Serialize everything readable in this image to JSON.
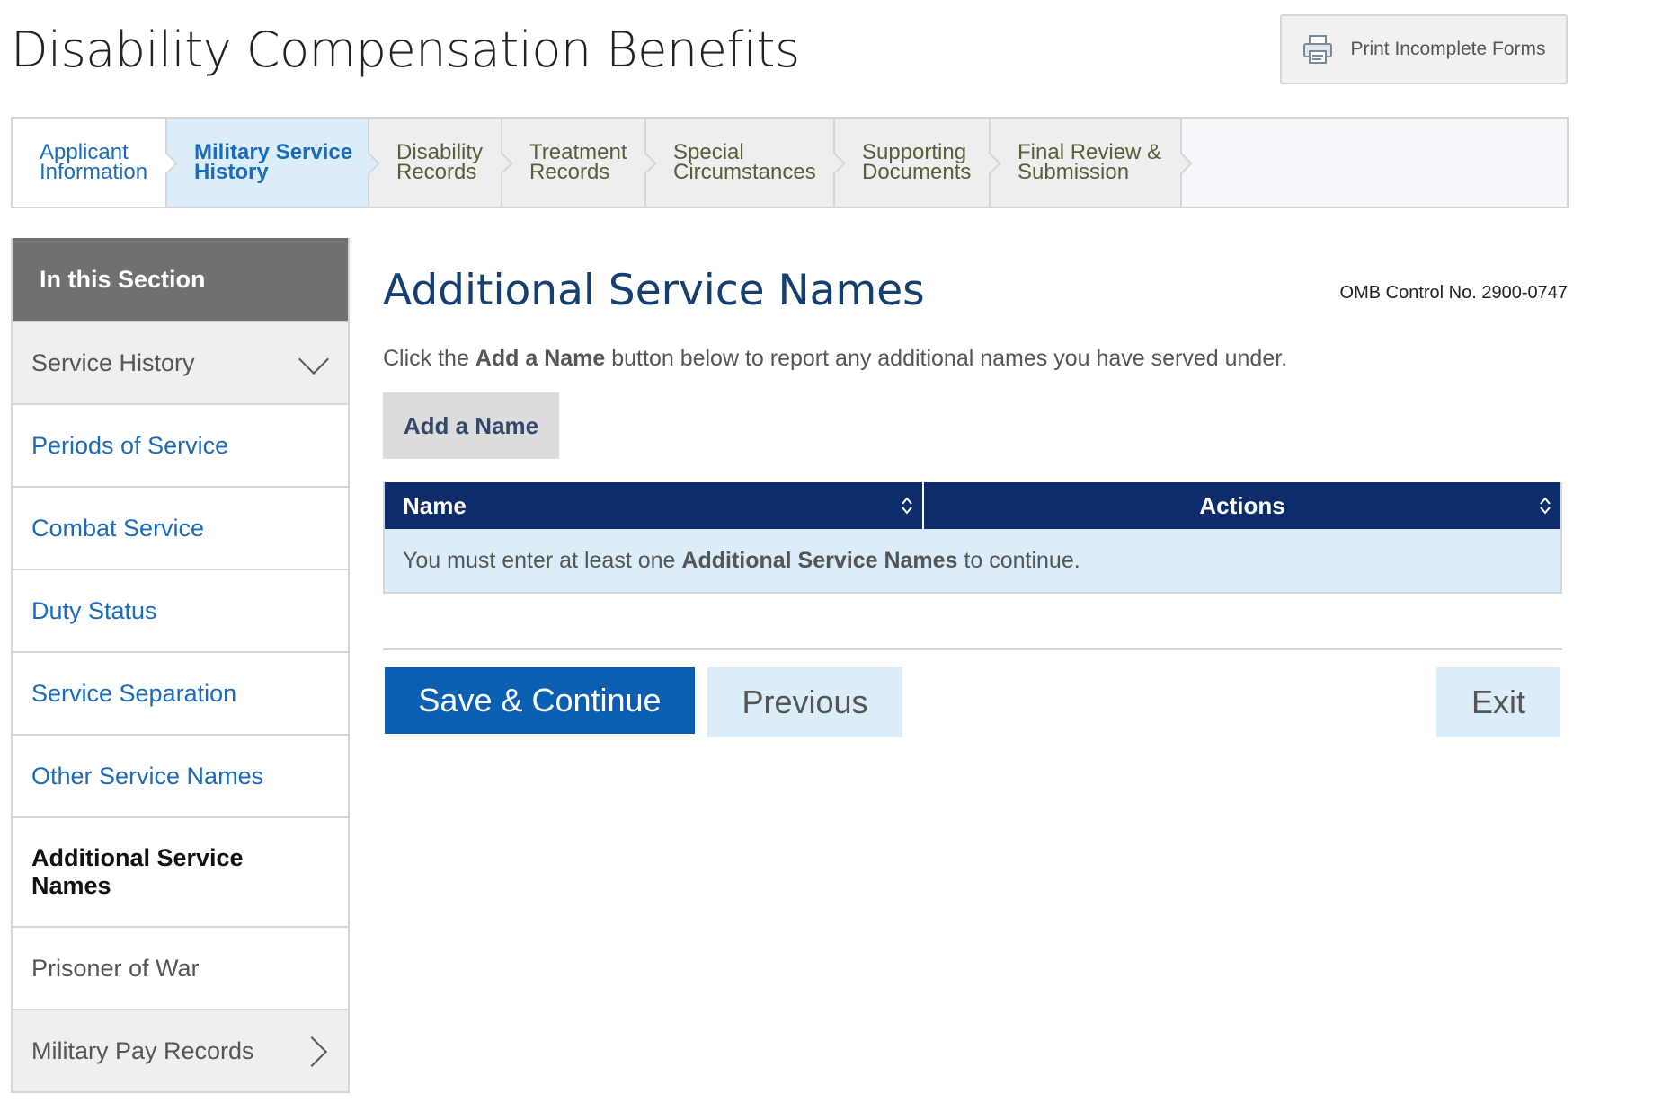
{
  "page": {
    "title": "Disability Compensation Benefits"
  },
  "print": {
    "label": "Print Incomplete Forms",
    "icon": "printer-icon"
  },
  "steps": [
    {
      "label": "Applicant\nInformation",
      "state": "done"
    },
    {
      "label": "Military Service\nHistory",
      "state": "active"
    },
    {
      "label": "Disability\nRecords",
      "state": "pending"
    },
    {
      "label": "Treatment\nRecords",
      "state": "pending"
    },
    {
      "label": "Special\nCircumstances",
      "state": "pending"
    },
    {
      "label": "Supporting\nDocuments",
      "state": "pending"
    },
    {
      "label": "Final Review &\nSubmission",
      "state": "pending"
    }
  ],
  "sidebar": {
    "heading": "In this Section",
    "items": [
      {
        "label": "Service History",
        "icon": "chevron-down-icon"
      },
      {
        "label": "Periods of Service"
      },
      {
        "label": "Combat Service"
      },
      {
        "label": "Duty Status"
      },
      {
        "label": "Service Separation"
      },
      {
        "label": "Other Service Names"
      },
      {
        "label": "Additional Service Names"
      },
      {
        "label": "Prisoner of War"
      },
      {
        "label": "Military Pay Records",
        "icon": "chevron-right-icon"
      }
    ]
  },
  "main": {
    "title": "Additional Service Names",
    "omb": "OMB Control No. 2900-0747",
    "instructions": {
      "prefix": "Click the ",
      "bold": "Add a Name",
      "suffix": " button below to report any additional names you have served under."
    },
    "add_button": "Add a Name",
    "table": {
      "columns": [
        "Name",
        "Actions"
      ],
      "empty": {
        "prefix": "You must enter at least one ",
        "bold": "Additional Service Names",
        "suffix": " to continue."
      }
    }
  },
  "footer": {
    "save": "Save & Continue",
    "previous": "Previous",
    "exit": "Exit"
  },
  "colors": {
    "primary": "#0b5fb2",
    "navy": "#0d2c6c",
    "title_blue": "#153f70",
    "link_blue": "#1c6bba",
    "light_blue": "#dcedfa"
  }
}
